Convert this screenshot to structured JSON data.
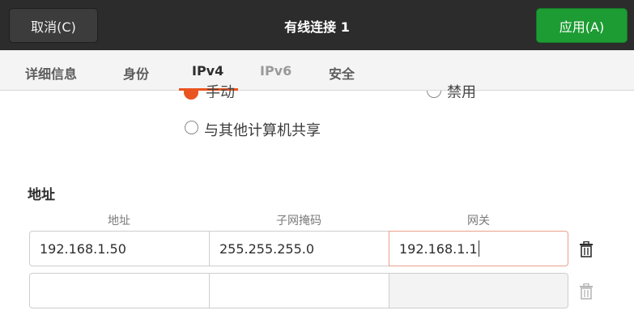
{
  "header": {
    "cancel_label": "取消(C)",
    "title": "有线连接 1",
    "apply_label": "应用(A)"
  },
  "tabs": [
    {
      "label": "详细信息"
    },
    {
      "label": "身份"
    },
    {
      "label": "IPv4",
      "active": true
    },
    {
      "label": "IPv6"
    },
    {
      "label": "安全"
    }
  ],
  "method": {
    "partial_option_1": "手动",
    "partial_option_2": "禁用",
    "share_label": "与其他计算机共享"
  },
  "addresses": {
    "section_title": "地址",
    "columns": [
      "地址",
      "子网掩码",
      "网关"
    ],
    "rows": [
      {
        "address": "192.168.1.50",
        "netmask": "255.255.255.0",
        "gateway": "192.168.1.1"
      },
      {
        "address": "",
        "netmask": "",
        "gateway": ""
      }
    ]
  },
  "icons": {
    "delete": "trash-icon",
    "radio": "radio-icon"
  },
  "colors": {
    "accent": "#e95420",
    "apply": "#1d9c33",
    "headerbar": "#2c2c2c"
  }
}
